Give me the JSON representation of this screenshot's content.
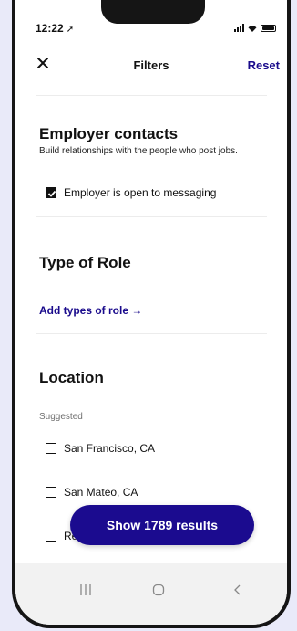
{
  "status_bar": {
    "time": "12:22"
  },
  "header": {
    "title": "Filters",
    "reset_label": "Reset"
  },
  "employer_contacts": {
    "title": "Employer contacts",
    "description": "Build relationships with the people who post jobs.",
    "option": {
      "label": "Employer is open to messaging",
      "checked": true
    }
  },
  "type_of_role": {
    "title": "Type of Role",
    "add_link": "Add types of role →"
  },
  "location": {
    "title": "Location",
    "suggested_label": "Suggested",
    "options": [
      {
        "label": "San Francisco, CA",
        "checked": false
      },
      {
        "label": "San Mateo, CA",
        "checked": false
      },
      {
        "label": "Re",
        "checked": false
      }
    ]
  },
  "results_button": {
    "label": "Show 1789 results"
  },
  "nav": {
    "recents_icon": "recents-icon",
    "home_icon": "home-icon",
    "back_icon": "back-icon"
  },
  "colors": {
    "accent": "#1b0b8f",
    "background": "#e9eaf9"
  }
}
